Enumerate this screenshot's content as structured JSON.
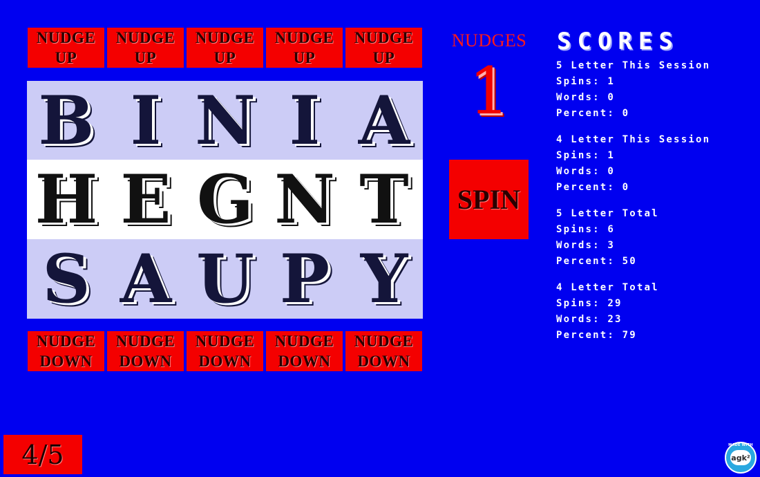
{
  "nudge_up": {
    "line1": "NUDGE",
    "line2": "UP"
  },
  "nudge_down": {
    "line1": "NUDGE",
    "line2": "DOWN"
  },
  "reels": [
    [
      "B",
      "I",
      "N",
      "I",
      "A"
    ],
    [
      "H",
      "E",
      "G",
      "N",
      "T"
    ],
    [
      "S",
      "A",
      "U",
      "P",
      "Y"
    ]
  ],
  "nudges": {
    "label": "NUDGES",
    "count": "1"
  },
  "spin_label": "SPIN",
  "scores": {
    "title": "SCORES",
    "blocks": [
      {
        "heading": "5 Letter This Session",
        "spins": "Spins: 1",
        "words": "Words: 0",
        "percent": "Percent: 0"
      },
      {
        "heading": "4 Letter This Session",
        "spins": "Spins: 1",
        "words": "Words: 0",
        "percent": "Percent: 0"
      },
      {
        "heading": "5 Letter Total",
        "spins": "Spins: 6",
        "words": "Words: 3",
        "percent": "Percent: 50"
      },
      {
        "heading": "4 Letter Total",
        "spins": "Spins: 29",
        "words": "Words: 23",
        "percent": "Percent: 79"
      }
    ]
  },
  "level": "4/5",
  "badge": {
    "top_text": "MADE WITH",
    "logo": "agk²",
    "icon": "agk-logo-icon"
  },
  "colors": {
    "background": "#0000f0",
    "button": "#f40000",
    "reel_light": "#ccccf6",
    "reel_mid": "#ffffff",
    "nudges_text": "#ff1a1a"
  }
}
